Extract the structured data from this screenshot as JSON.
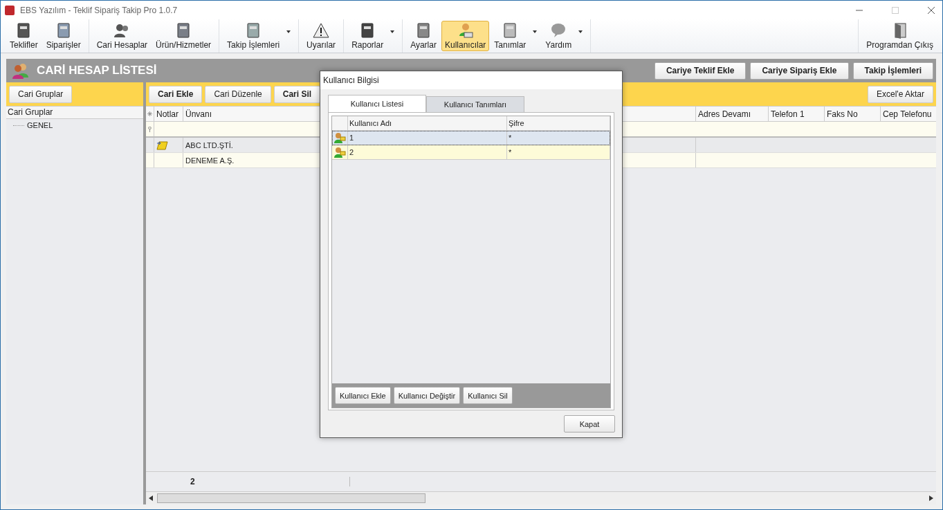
{
  "window": {
    "title": "EBS Yazılım - Teklif Sipariş Takip Pro 1.0.7"
  },
  "toolbar": {
    "groups": [
      [
        {
          "label": "Teklifler",
          "selected": false,
          "dropdown": false
        },
        {
          "label": "Siparişler",
          "selected": false,
          "dropdown": false
        }
      ],
      [
        {
          "label": "Cari Hesaplar",
          "selected": false,
          "dropdown": false
        },
        {
          "label": "Ürün/Hizmetler",
          "selected": false,
          "dropdown": false
        }
      ],
      [
        {
          "label": "Takip İşlemleri",
          "selected": false,
          "dropdown": true
        }
      ],
      [
        {
          "label": "Uyarılar",
          "selected": false,
          "dropdown": false
        }
      ],
      [
        {
          "label": "Raporlar",
          "selected": false,
          "dropdown": true
        }
      ],
      [
        {
          "label": "Ayarlar",
          "selected": false,
          "dropdown": false
        },
        {
          "label": "Kullanıcılar",
          "selected": true,
          "dropdown": false
        },
        {
          "label": "Tanımlar",
          "selected": false,
          "dropdown": true
        },
        {
          "label": "Yardım",
          "selected": false,
          "dropdown": true
        }
      ]
    ],
    "exit": {
      "label": "Programdan Çıkış"
    }
  },
  "panel": {
    "title": "CARİ HESAP LİSTESİ",
    "header_buttons": [
      "Cariye Teklif Ekle",
      "Cariye Sipariş Ekle",
      "Takip İşlemleri"
    ]
  },
  "groups_panel": {
    "button": "Cari Gruplar",
    "tree": {
      "label": "Cari Gruplar",
      "children": [
        {
          "label": "GENEL",
          "selected": false
        }
      ]
    }
  },
  "accounts": {
    "buttons": [
      {
        "label": "Cari Ekle",
        "bold": true
      },
      {
        "label": "Cari Düzenle",
        "bold": false
      },
      {
        "label": "Cari Sil",
        "bold": true
      }
    ],
    "export_button": "Excel'e Aktar",
    "columns": [
      "Notlar",
      "Ünvanı",
      "Adres Devamı",
      "Telefon 1",
      "Faks No",
      "Cep Telefonu"
    ],
    "rows": [
      {
        "has_note": true,
        "title": "ABC LTD.ŞTİ.",
        "selected": true
      },
      {
        "has_note": false,
        "title": "DENEME A.Ş.",
        "selected": false
      }
    ],
    "footer_count": "2"
  },
  "dialog": {
    "title": "Kullanıcı Bilgisi",
    "tabs": [
      {
        "label": "Kullanıcı Listesi",
        "selected": true
      },
      {
        "label": "Kullanıcı Tanımları",
        "selected": false
      }
    ],
    "columns": [
      "Kullanıcı Adı",
      "Şifre"
    ],
    "rows": [
      {
        "name": "1",
        "password": "*",
        "selected": true
      },
      {
        "name": "2",
        "password": "*",
        "selected": false
      }
    ],
    "buttons": [
      "Kullanıcı Ekle",
      "Kullanıcı Değiştir",
      "Kullanıcı Sil"
    ],
    "close_button": "Kapat"
  }
}
